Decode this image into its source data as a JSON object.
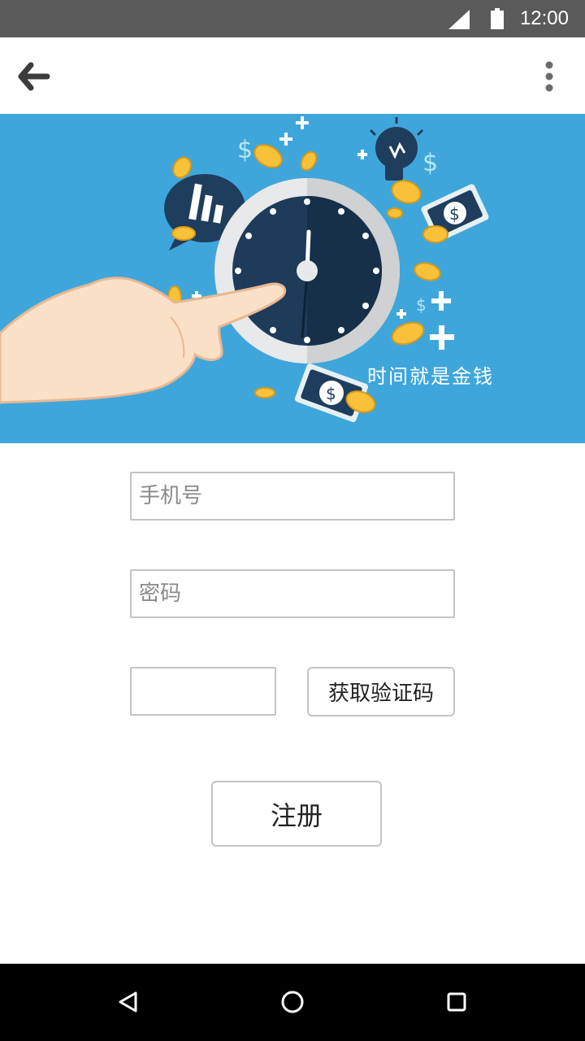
{
  "status_bar": {
    "time": "12:00",
    "icons": [
      "signal-icon",
      "battery-icon"
    ]
  },
  "app_bar": {
    "back_icon": "arrow-back-icon",
    "menu_icon": "more-vert-icon"
  },
  "banner": {
    "caption": "时间就是金钱",
    "colors": {
      "background": "#3fa6dc",
      "coin": "#f7c23a",
      "clock_face": "#1e3b5a"
    }
  },
  "form": {
    "phone_placeholder": "手机号",
    "password_placeholder": "密码",
    "code_value": "",
    "get_code_label": "获取验证码",
    "register_label": "注册"
  },
  "nav_bar": {
    "icons": [
      "back-triangle-icon",
      "home-circle-icon",
      "recents-square-icon"
    ]
  }
}
